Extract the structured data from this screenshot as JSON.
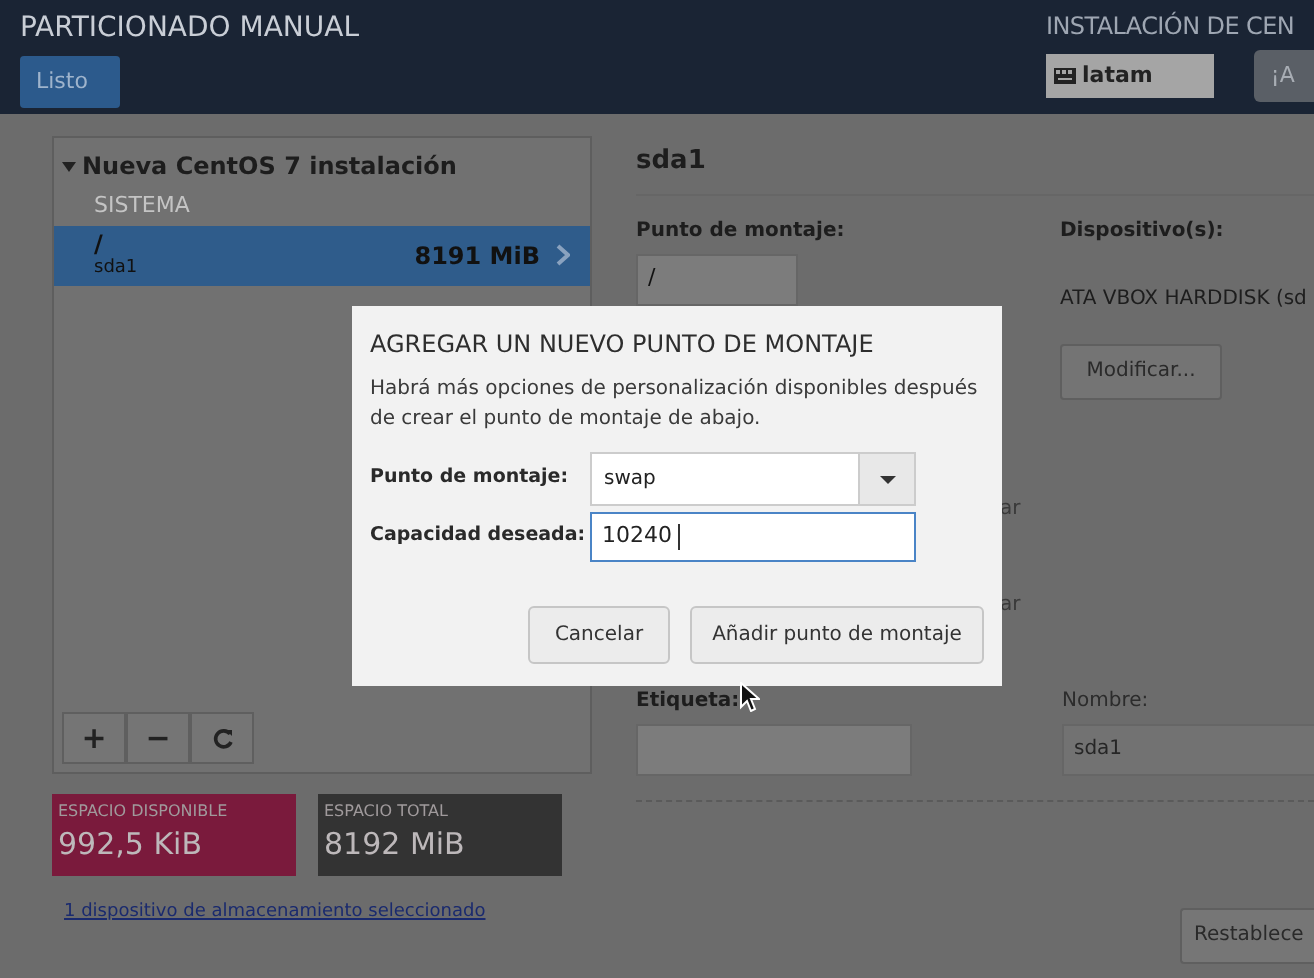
{
  "header": {
    "title": "PARTICIONADO MANUAL",
    "done_button": "Listo",
    "install_title": "INSTALACIÓN DE CEN",
    "keyboard_layout": "latam",
    "help_button": "¡A"
  },
  "partitions": {
    "group": "Nueva CentOS 7 instalación",
    "expanded": true,
    "section": "SISTEMA",
    "items": [
      {
        "mount": "/",
        "device": "sda1",
        "size": "8191 MiB",
        "selected": true
      }
    ],
    "toolbar": [
      {
        "kind": "text",
        "label": "+"
      },
      {
        "kind": "text",
        "label": "−"
      },
      {
        "kind": "refresh"
      }
    ]
  },
  "space": [
    {
      "label": "ESPACIO DISPONIBLE",
      "value": "992,5 KiB",
      "color": "#7a1a3c"
    },
    {
      "label": "ESPACIO TOTAL",
      "value": "8192 MiB",
      "color": "#333333"
    }
  ],
  "storage_link": "1 dispositivo de almacenamiento seleccionado",
  "details": {
    "title": "sda1",
    "mount_label": "Punto de montaje:",
    "mount_value": "/",
    "devices_label": "Dispositivo(s):",
    "device": "ATA VBOX HARDDISK (sd",
    "modify_button": "Modificar...",
    "label_fragments": [
      "ar",
      "ar"
    ],
    "label_label": "Etiqueta:",
    "name_label": "Nombre:",
    "name_value": "sda1",
    "reset_button": "Restablece"
  },
  "dialog": {
    "title": "AGREGAR UN NUEVO PUNTO DE MONTAJE",
    "description": "Habrá más opciones de personalización disponibles después de crear el punto de montaje de abajo.",
    "mount_label": "Punto de montaje:",
    "mount_value": "swap",
    "capacity_label": "Capacidad deseada:",
    "capacity_value": "10240",
    "buttons": [
      "Cancelar",
      "Añadir punto de montaje"
    ]
  }
}
